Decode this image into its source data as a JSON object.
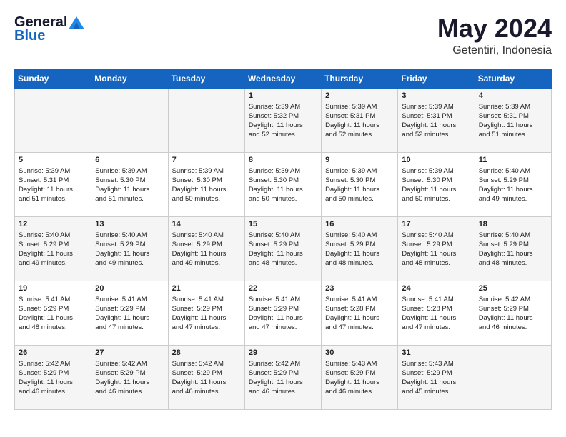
{
  "header": {
    "logo_general": "General",
    "logo_blue": "Blue",
    "month": "May 2024",
    "location": "Getentiri, Indonesia"
  },
  "weekdays": [
    "Sunday",
    "Monday",
    "Tuesday",
    "Wednesday",
    "Thursday",
    "Friday",
    "Saturday"
  ],
  "weeks": [
    [
      {
        "day": "",
        "info": ""
      },
      {
        "day": "",
        "info": ""
      },
      {
        "day": "",
        "info": ""
      },
      {
        "day": "1",
        "info": "Sunrise: 5:39 AM\nSunset: 5:32 PM\nDaylight: 11 hours\nand 52 minutes."
      },
      {
        "day": "2",
        "info": "Sunrise: 5:39 AM\nSunset: 5:31 PM\nDaylight: 11 hours\nand 52 minutes."
      },
      {
        "day": "3",
        "info": "Sunrise: 5:39 AM\nSunset: 5:31 PM\nDaylight: 11 hours\nand 52 minutes."
      },
      {
        "day": "4",
        "info": "Sunrise: 5:39 AM\nSunset: 5:31 PM\nDaylight: 11 hours\nand 51 minutes."
      }
    ],
    [
      {
        "day": "5",
        "info": "Sunrise: 5:39 AM\nSunset: 5:31 PM\nDaylight: 11 hours\nand 51 minutes."
      },
      {
        "day": "6",
        "info": "Sunrise: 5:39 AM\nSunset: 5:30 PM\nDaylight: 11 hours\nand 51 minutes."
      },
      {
        "day": "7",
        "info": "Sunrise: 5:39 AM\nSunset: 5:30 PM\nDaylight: 11 hours\nand 50 minutes."
      },
      {
        "day": "8",
        "info": "Sunrise: 5:39 AM\nSunset: 5:30 PM\nDaylight: 11 hours\nand 50 minutes."
      },
      {
        "day": "9",
        "info": "Sunrise: 5:39 AM\nSunset: 5:30 PM\nDaylight: 11 hours\nand 50 minutes."
      },
      {
        "day": "10",
        "info": "Sunrise: 5:39 AM\nSunset: 5:30 PM\nDaylight: 11 hours\nand 50 minutes."
      },
      {
        "day": "11",
        "info": "Sunrise: 5:40 AM\nSunset: 5:29 PM\nDaylight: 11 hours\nand 49 minutes."
      }
    ],
    [
      {
        "day": "12",
        "info": "Sunrise: 5:40 AM\nSunset: 5:29 PM\nDaylight: 11 hours\nand 49 minutes."
      },
      {
        "day": "13",
        "info": "Sunrise: 5:40 AM\nSunset: 5:29 PM\nDaylight: 11 hours\nand 49 minutes."
      },
      {
        "day": "14",
        "info": "Sunrise: 5:40 AM\nSunset: 5:29 PM\nDaylight: 11 hours\nand 49 minutes."
      },
      {
        "day": "15",
        "info": "Sunrise: 5:40 AM\nSunset: 5:29 PM\nDaylight: 11 hours\nand 48 minutes."
      },
      {
        "day": "16",
        "info": "Sunrise: 5:40 AM\nSunset: 5:29 PM\nDaylight: 11 hours\nand 48 minutes."
      },
      {
        "day": "17",
        "info": "Sunrise: 5:40 AM\nSunset: 5:29 PM\nDaylight: 11 hours\nand 48 minutes."
      },
      {
        "day": "18",
        "info": "Sunrise: 5:40 AM\nSunset: 5:29 PM\nDaylight: 11 hours\nand 48 minutes."
      }
    ],
    [
      {
        "day": "19",
        "info": "Sunrise: 5:41 AM\nSunset: 5:29 PM\nDaylight: 11 hours\nand 48 minutes."
      },
      {
        "day": "20",
        "info": "Sunrise: 5:41 AM\nSunset: 5:29 PM\nDaylight: 11 hours\nand 47 minutes."
      },
      {
        "day": "21",
        "info": "Sunrise: 5:41 AM\nSunset: 5:29 PM\nDaylight: 11 hours\nand 47 minutes."
      },
      {
        "day": "22",
        "info": "Sunrise: 5:41 AM\nSunset: 5:29 PM\nDaylight: 11 hours\nand 47 minutes."
      },
      {
        "day": "23",
        "info": "Sunrise: 5:41 AM\nSunset: 5:28 PM\nDaylight: 11 hours\nand 47 minutes."
      },
      {
        "day": "24",
        "info": "Sunrise: 5:41 AM\nSunset: 5:28 PM\nDaylight: 11 hours\nand 47 minutes."
      },
      {
        "day": "25",
        "info": "Sunrise: 5:42 AM\nSunset: 5:29 PM\nDaylight: 11 hours\nand 46 minutes."
      }
    ],
    [
      {
        "day": "26",
        "info": "Sunrise: 5:42 AM\nSunset: 5:29 PM\nDaylight: 11 hours\nand 46 minutes."
      },
      {
        "day": "27",
        "info": "Sunrise: 5:42 AM\nSunset: 5:29 PM\nDaylight: 11 hours\nand 46 minutes."
      },
      {
        "day": "28",
        "info": "Sunrise: 5:42 AM\nSunset: 5:29 PM\nDaylight: 11 hours\nand 46 minutes."
      },
      {
        "day": "29",
        "info": "Sunrise: 5:42 AM\nSunset: 5:29 PM\nDaylight: 11 hours\nand 46 minutes."
      },
      {
        "day": "30",
        "info": "Sunrise: 5:43 AM\nSunset: 5:29 PM\nDaylight: 11 hours\nand 46 minutes."
      },
      {
        "day": "31",
        "info": "Sunrise: 5:43 AM\nSunset: 5:29 PM\nDaylight: 11 hours\nand 45 minutes."
      },
      {
        "day": "",
        "info": ""
      }
    ]
  ]
}
